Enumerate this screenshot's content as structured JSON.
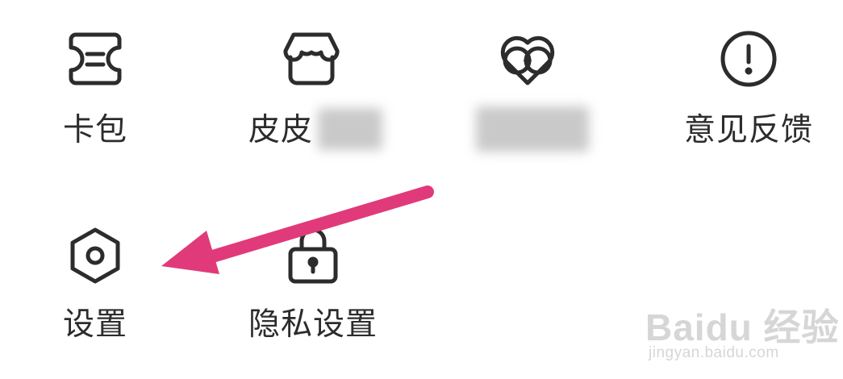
{
  "menu": {
    "items": [
      {
        "label": "卡包",
        "icon": "card-wallet-icon"
      },
      {
        "label": "皮皮",
        "icon": "shop-icon",
        "blurred": true
      },
      {
        "label": "",
        "icon": "heart-coin-icon",
        "blurred": true
      },
      {
        "label": "意见反馈",
        "icon": "exclamation-circle-icon"
      },
      {
        "label": "设置",
        "icon": "settings-hexagon-icon"
      },
      {
        "label": "隐私设置",
        "icon": "lock-icon"
      }
    ]
  },
  "annotation": {
    "arrow_color": "#e03a7a"
  },
  "watermark": {
    "logo": "Baidu 经验",
    "url": "jingyan.baidu.com"
  },
  "colors": {
    "icon_stroke": "#2c2c2c",
    "text": "#2c2c2c",
    "background": "#ffffff"
  }
}
